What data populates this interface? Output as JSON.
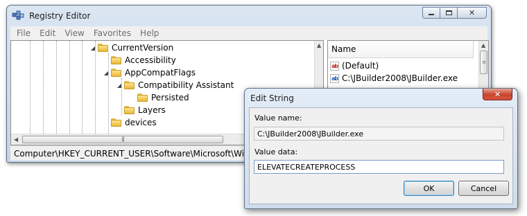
{
  "registry_window": {
    "title": "Registry Editor",
    "menu": [
      "File",
      "Edit",
      "View",
      "Favorites",
      "Help"
    ],
    "tree": [
      {
        "label": "CurrentVersion",
        "expander": "◢"
      },
      {
        "label": "Accessibility",
        "expander": ""
      },
      {
        "label": "AppCompatFlags",
        "expander": "◢"
      },
      {
        "label": "Compatibility Assistant",
        "expander": "◢"
      },
      {
        "label": "Persisted",
        "expander": ""
      },
      {
        "label": "Layers",
        "expander": ""
      },
      {
        "label": "devices",
        "expander": ""
      }
    ],
    "list_header": "Name",
    "list_items": [
      "(Default)",
      "C:\\JBuilder2008\\JBuilder.exe"
    ],
    "status_path": "Computer\\HKEY_CURRENT_USER\\Software\\Microsoft\\Windows NT\\CurrentVersion\\AppCompatFlags\\Layers",
    "icons": {
      "app": "registry-editor-icon",
      "folder": "folder-icon",
      "string_value": "ab-string-icon"
    }
  },
  "dialog": {
    "title": "Edit String",
    "value_name_label": "Value name:",
    "value_name": "C:\\JBuilder2008\\JBuilder.exe",
    "value_data_label": "Value data:",
    "value_data": "ELEVATECREATEPROCESS",
    "ok_label": "OK",
    "cancel_label": "Cancel"
  },
  "colors": {
    "folder": "#f0c84e",
    "close_button": "#c8442e",
    "frame": "#c4d4e6"
  }
}
